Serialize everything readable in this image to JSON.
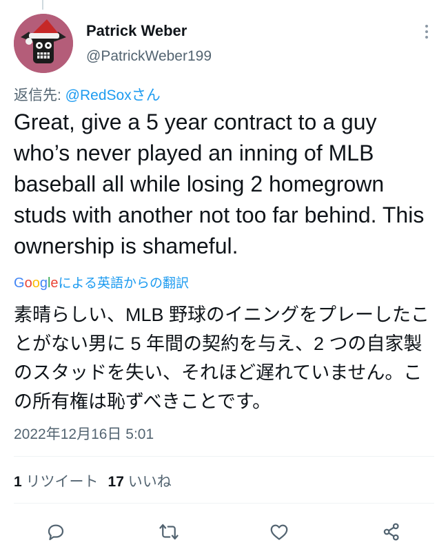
{
  "author": {
    "name": "Patrick Weber",
    "handle": "@PatrickWeber199",
    "avatar": "santa-hat-creature-avatar"
  },
  "reply": {
    "prefix": "返信先: ",
    "mention": "@RedSox",
    "suffix": "さん"
  },
  "tweet": {
    "text": "Great, give a 5 year contract to a guy who’s never played an inning of MLB baseball all while losing 2 homegrown studs with another not too far behind. This ownership is shameful."
  },
  "translation": {
    "logo_letters": [
      "G",
      "o",
      "o",
      "g",
      "l",
      "e"
    ],
    "link_label": "による英語からの翻訳",
    "text": "素晴らしい、MLB 野球のイニングをプレーしたことがない男に 5 年間の契約を与え、2 つの自家製のスタッドを失い、それほど遅れていません。この所有権は恥ずべきことです。"
  },
  "timestamp": "2022年12月16日 5:01",
  "stats": {
    "retweet_count": "1",
    "retweet_label": "リツイート",
    "like_count": "17",
    "like_label": "いいね"
  },
  "icons": {
    "more": "more-vertical-icon",
    "reply": "reply-icon",
    "retweet": "retweet-icon",
    "like": "heart-icon",
    "share": "share-icon"
  },
  "colors": {
    "text": "#0f1419",
    "secondary": "#536471",
    "link": "#1d9bf0",
    "divider": "#eff3f4",
    "avatar_bg": "#b45d79"
  }
}
